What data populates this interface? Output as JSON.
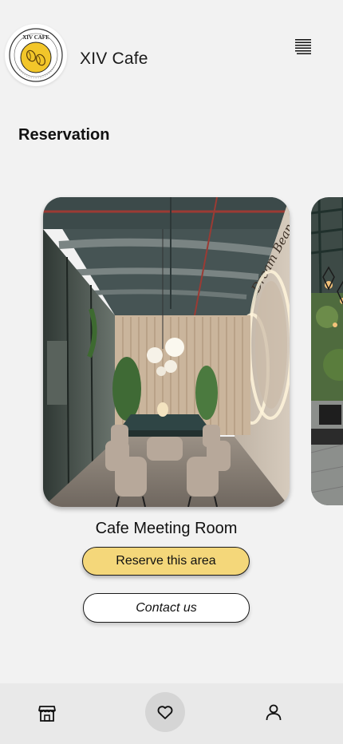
{
  "header": {
    "app_title": "XIV Cafe",
    "logo_text_top": "XIV CAFE",
    "logo_text_ring": "YOUR DAILY CAFFEINE FIX",
    "menu_icon": "menu-icon"
  },
  "section": {
    "title": "Reservation"
  },
  "cards": [
    {
      "name": "Cafe Meeting Room",
      "photo_sign_text": "Dream Bean Coffee Shop",
      "reserve_label": "Reserve this area",
      "contact_label": "Contact us"
    }
  ],
  "bottom_nav": {
    "items": [
      {
        "icon": "store-icon",
        "active": false
      },
      {
        "icon": "heart-icon",
        "active": true
      },
      {
        "icon": "user-icon",
        "active": false
      }
    ]
  },
  "colors": {
    "background": "#f2f2f2",
    "reserve_button": "#f4d77a",
    "nav_background": "#e9e9e9",
    "nav_active": "#d5d5d5"
  }
}
